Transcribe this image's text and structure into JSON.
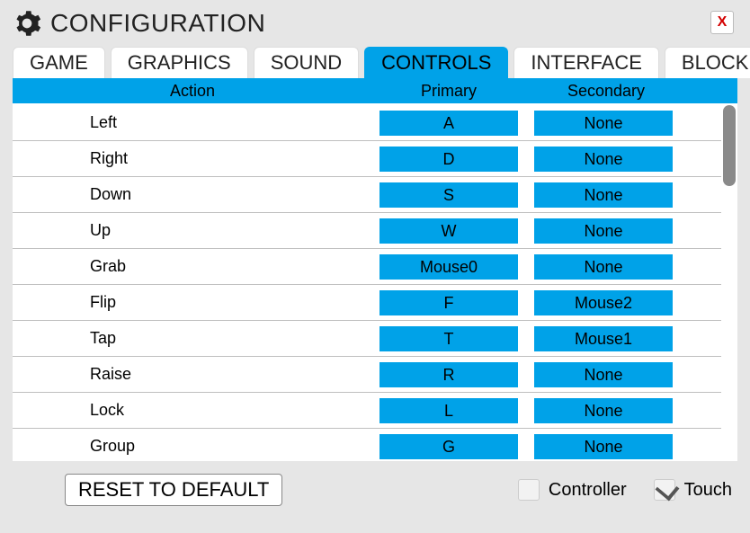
{
  "title": "CONFIGURATION",
  "close_label": "X",
  "tabs": [
    {
      "label": "GAME",
      "active": false
    },
    {
      "label": "GRAPHICS",
      "active": false
    },
    {
      "label": "SOUND",
      "active": false
    },
    {
      "label": "CONTROLS",
      "active": true
    },
    {
      "label": "INTERFACE",
      "active": false
    },
    {
      "label": "BLOCKED",
      "active": false
    }
  ],
  "headers": {
    "action": "Action",
    "primary": "Primary",
    "secondary": "Secondary"
  },
  "bindings": [
    {
      "action": "Left",
      "primary": "A",
      "secondary": "None"
    },
    {
      "action": "Right",
      "primary": "D",
      "secondary": "None"
    },
    {
      "action": "Down",
      "primary": "S",
      "secondary": "None"
    },
    {
      "action": "Up",
      "primary": "W",
      "secondary": "None"
    },
    {
      "action": "Grab",
      "primary": "Mouse0",
      "secondary": "None"
    },
    {
      "action": "Flip",
      "primary": "F",
      "secondary": "Mouse2"
    },
    {
      "action": "Tap",
      "primary": "T",
      "secondary": "Mouse1"
    },
    {
      "action": "Raise",
      "primary": "R",
      "secondary": "None"
    },
    {
      "action": "Lock",
      "primary": "L",
      "secondary": "None"
    },
    {
      "action": "Group",
      "primary": "G",
      "secondary": "None"
    }
  ],
  "reset_label": "RESET TO DEFAULT",
  "checks": {
    "controller": {
      "label": "Controller",
      "checked": false
    },
    "touch": {
      "label": "Touch",
      "checked": true
    }
  },
  "colors": {
    "accent": "#00a2e8",
    "bg": "#e6e6e6"
  }
}
